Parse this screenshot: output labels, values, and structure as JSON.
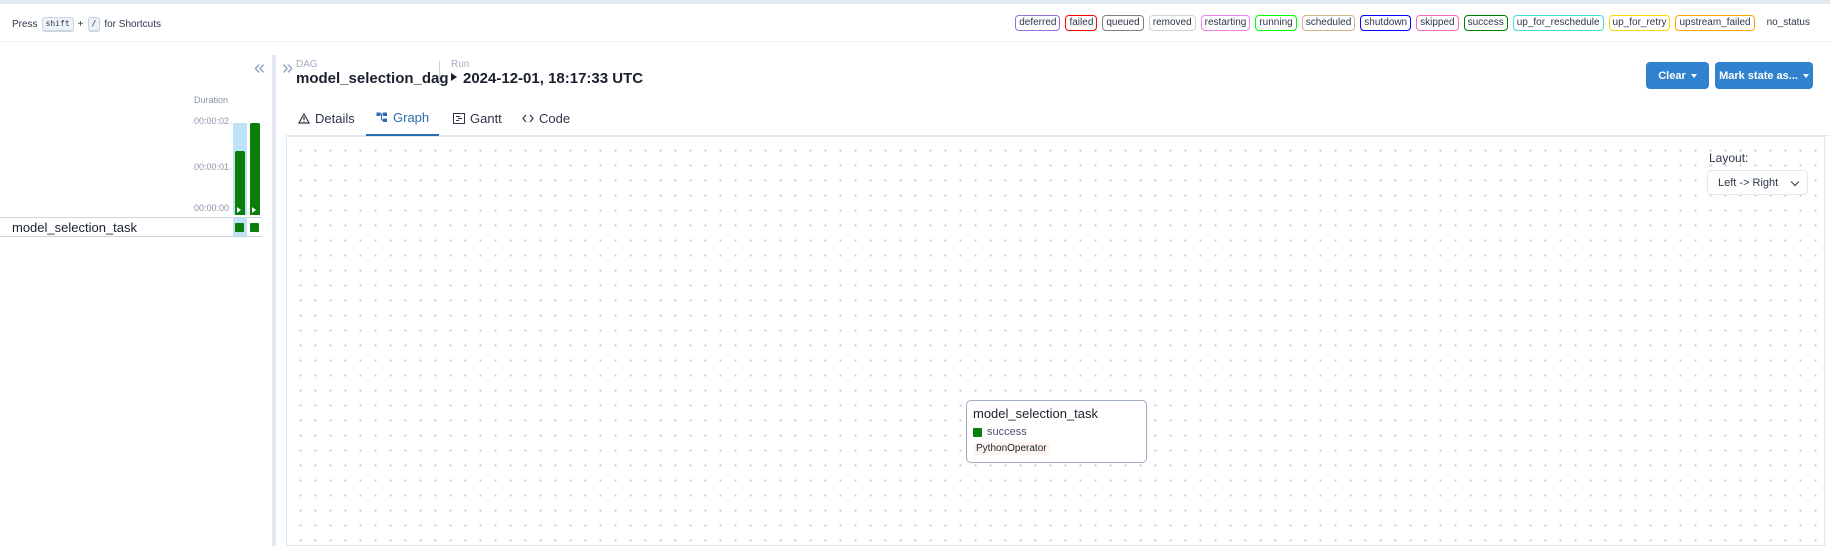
{
  "shortcut": {
    "press": "Press",
    "key1": "shift",
    "plus": "+",
    "key2": "/",
    "suffix": "for Shortcuts"
  },
  "states": [
    {
      "label": "deferred",
      "color": "#9370db"
    },
    {
      "label": "failed",
      "color": "#ff0000"
    },
    {
      "label": "queued",
      "color": "#808080"
    },
    {
      "label": "removed",
      "color": "#d3d3d3"
    },
    {
      "label": "restarting",
      "color": "#ee82ee"
    },
    {
      "label": "running",
      "color": "#00ff00"
    },
    {
      "label": "scheduled",
      "color": "#d2b48c"
    },
    {
      "label": "shutdown",
      "color": "#0000ff"
    },
    {
      "label": "skipped",
      "color": "#ff69b4"
    },
    {
      "label": "success",
      "color": "#008000"
    },
    {
      "label": "up_for_reschedule",
      "color": "#40e0d0"
    },
    {
      "label": "up_for_retry",
      "color": "#ffd700"
    },
    {
      "label": "upstream_failed",
      "color": "#ffa500"
    },
    {
      "label": "no_status",
      "color": ""
    }
  ],
  "grid": {
    "duration_label": "Duration",
    "ticks": [
      "00:00:02",
      "00:00:01",
      "00:00:00"
    ],
    "runs": [
      {
        "duration_seconds": 1.4,
        "state": "success",
        "selected": true
      },
      {
        "duration_seconds": 2.0,
        "state": "success",
        "selected": false
      }
    ],
    "task_name": "model_selection_task"
  },
  "header": {
    "dag_label": "DAG",
    "dag_id": "model_selection_dag",
    "run_label": "Run",
    "run_id": "2024-12-01, 18:17:33 UTC",
    "clear_button": "Clear",
    "mark_state_button": "Mark state as..."
  },
  "tabs": [
    {
      "label": "Details",
      "icon": "warning-triangle-icon"
    },
    {
      "label": "Graph",
      "icon": "graph-icon",
      "active": true
    },
    {
      "label": "Gantt",
      "icon": "gantt-icon"
    },
    {
      "label": "Code",
      "icon": "code-icon"
    }
  ],
  "graph": {
    "layout_label": "Layout:",
    "layout_value": "Left -> Right",
    "node": {
      "task_id": "model_selection_task",
      "state": "success",
      "operator": "PythonOperator",
      "state_color": "#008000"
    }
  },
  "colors": {
    "accent": "#3182ce",
    "success": "#0a7d0a",
    "selected": "#bee3f8"
  }
}
